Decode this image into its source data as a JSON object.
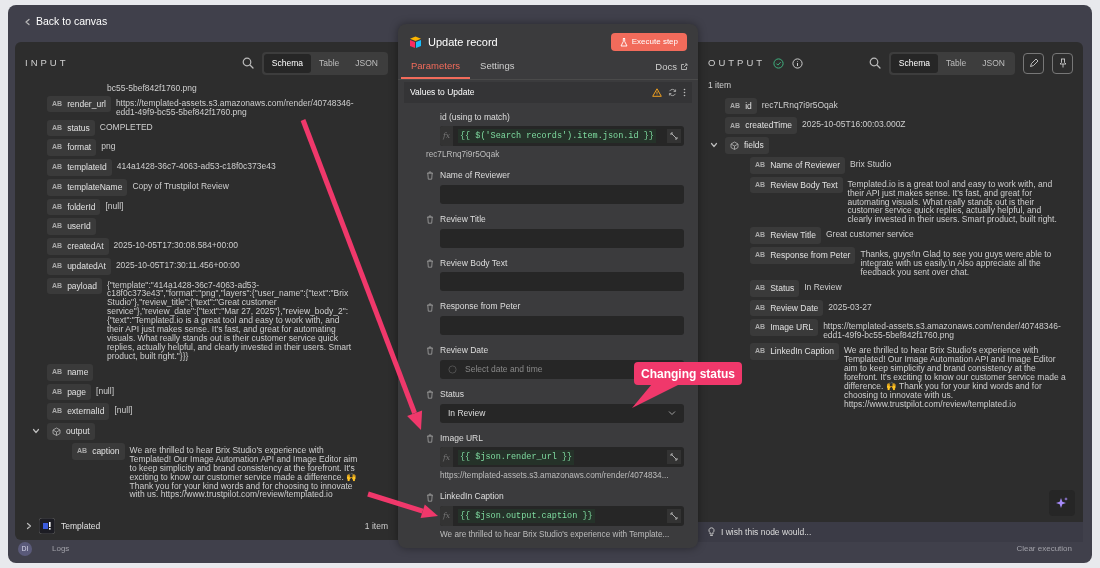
{
  "top_bar": {
    "back_label": "Back to canvas"
  },
  "input_panel": {
    "title": "INPUT",
    "view_tabs": [
      {
        "label": "Schema",
        "selected": true
      },
      {
        "label": "Table",
        "selected": false
      },
      {
        "label": "JSON",
        "selected": false
      }
    ],
    "fields": [
      {
        "kind": "partial",
        "value": "bc55-5bef842f1760.png"
      },
      {
        "kind": "string",
        "type_label": "AB",
        "key": "render_url",
        "value": "https://templated-assets.s3.amazonaws.com/render/40748346-edd1-49f9-bc55-5bef842f1760.png"
      },
      {
        "kind": "string",
        "type_label": "AB",
        "key": "status",
        "value": "COMPLETED"
      },
      {
        "kind": "string",
        "type_label": "AB",
        "key": "format",
        "value": "png"
      },
      {
        "kind": "string",
        "type_label": "AB",
        "key": "templateId",
        "value": "414a1428-36c7-4063-ad53-c18f0c373e43"
      },
      {
        "kind": "string",
        "type_label": "AB",
        "key": "templateName",
        "value": "Copy of Trustpilot Review"
      },
      {
        "kind": "string",
        "type_label": "AB",
        "key": "folderId",
        "value": "[null]"
      },
      {
        "kind": "string",
        "type_label": "AB",
        "key": "userId"
      },
      {
        "kind": "string",
        "type_label": "AB",
        "key": "createdAt",
        "value": "2025-10-05T17:30:08.584+00:00"
      },
      {
        "kind": "string",
        "type_label": "AB",
        "key": "updatedAt",
        "value": "2025-10-05T17:30:11.456+00:00"
      },
      {
        "kind": "string",
        "type_label": "AB",
        "key": "payload",
        "value": "{\"template\":\"414a1428-36c7-4063-ad53-c18f0c373e43\",\"format\":\"png\",\"layers\":{\"user_name\":{\"text\":\"Brix Studio\"},\"review_title\":{\"text\":\"Great customer service\"},\"review_date\":{\"text\":\"Mar 27, 2025\"},\"review_body_2\":{\"text\":\"Templated.io is a great tool and easy to work with, and their API just makes sense. It's fast, and great for automating visuals. What really stands out is their customer service quick replies, actually helpful, and clearly invested in their users. Smart product, built right.\"}}}"
      },
      {
        "kind": "string",
        "type_label": "AB",
        "key": "name"
      },
      {
        "kind": "string",
        "type_label": "AB",
        "key": "page",
        "value": "[null]"
      },
      {
        "kind": "string",
        "type_label": "AB",
        "key": "externalId",
        "value": "[null]"
      },
      {
        "kind": "object",
        "key": "output",
        "expanded": true,
        "children": [
          {
            "kind": "string",
            "type_label": "AB",
            "key": "caption",
            "value": "We are thrilled to hear Brix Studio's experience with Templated! Our Image Automation API and Image Editor aim to keep simplicity and brand consistency at the forefront. It's exciting to know our customer service made a difference. 🙌 Thank you for your kind words and for choosing to innovate with us. https://www.trustpilot.com/review/templated.io"
          }
        ]
      }
    ],
    "source_node": {
      "name": "Templated",
      "count": "1 item",
      "expanded": false
    }
  },
  "node_panel": {
    "title": "Update record",
    "execute_label": "Execute step",
    "tabs": [
      {
        "label": "Parameters",
        "selected": true
      },
      {
        "label": "Settings",
        "selected": false
      }
    ],
    "docs_label": "Docs",
    "section_title": "Values to Update",
    "fields": [
      {
        "kind": "expression",
        "label": "id (using to match)",
        "removable": false,
        "prefix": "fx",
        "expression": "{{ $('Search records').item.json.id }}",
        "result": "rec7LRnq7i9r5Oqak"
      },
      {
        "kind": "text",
        "label": "Name of Reviewer",
        "removable": true
      },
      {
        "kind": "text",
        "label": "Review Title",
        "removable": true
      },
      {
        "kind": "text",
        "label": "Review Body Text",
        "removable": true
      },
      {
        "kind": "text",
        "label": "Response from Peter",
        "removable": true
      },
      {
        "kind": "date",
        "label": "Review Date",
        "removable": true,
        "placeholder": "Select date and time"
      },
      {
        "kind": "select",
        "label": "Status",
        "removable": true,
        "value": "In Review"
      },
      {
        "kind": "expression",
        "label": "Image URL",
        "removable": true,
        "prefix": "fx",
        "expression": "{{ $json.render_url }}",
        "result": "https://templated-assets.s3.amazonaws.com/render/4074834..."
      },
      {
        "kind": "expression",
        "label": "LinkedIn Caption",
        "removable": true,
        "prefix": "fx",
        "expression": "{{ $json.output.caption }}",
        "result": "We are thrilled to hear Brix Studio's experience with Template..."
      }
    ]
  },
  "output_panel": {
    "title": "OUTPUT",
    "item_count": "1 item",
    "view_tabs": [
      {
        "label": "Schema",
        "selected": true
      },
      {
        "label": "Table",
        "selected": false
      },
      {
        "label": "JSON",
        "selected": false
      }
    ],
    "fields": [
      {
        "kind": "string",
        "type_label": "AB",
        "key": "id",
        "value": "rec7LRnq7i9r5Oqak"
      },
      {
        "kind": "string",
        "type_label": "AB",
        "key": "createdTime",
        "value": "2025-10-05T16:00:03.000Z"
      },
      {
        "kind": "object",
        "key": "fields",
        "expanded": true,
        "children": [
          {
            "kind": "string",
            "type_label": "AB",
            "key": "Name of Reviewer",
            "value": "Brix Studio"
          },
          {
            "kind": "string",
            "type_label": "AB",
            "key": "Review Body Text",
            "value": "Templated.io is a great tool and easy to work with, and their API just makes sense. It's fast, and great for automating visuals. What really stands out is their customer service quick replies, actually helpful, and clearly invested in their users. Smart product, built right."
          },
          {
            "kind": "string",
            "type_label": "AB",
            "key": "Review Title",
            "value": "Great customer service"
          },
          {
            "kind": "string",
            "type_label": "AB",
            "key": "Response from Peter",
            "value": "Thanks, guys!\\n Glad to see you guys were able to integrate with us easily.\\n Also appreciate all the feedback you sent over chat."
          },
          {
            "kind": "string",
            "type_label": "AB",
            "key": "Status",
            "value": "In Review"
          },
          {
            "kind": "string",
            "type_label": "AB",
            "key": "Review Date",
            "value": "2025-03-27"
          },
          {
            "kind": "string",
            "type_label": "AB",
            "key": "Image URL",
            "value": "https://templated-assets.s3.amazonaws.com/render/40748346-edd1-49f9-bc55-5bef842f1760.png"
          },
          {
            "kind": "string",
            "type_label": "AB",
            "key": "LinkedIn Caption",
            "value": "We are thrilled to hear Brix Studio's experience with Templated! Our Image Automation API and Image Editor aim to keep simplicity and brand consistency at the forefront. It's exciting to know our customer service made a difference. 🙌 Thank you for your kind words and for choosing to innovate with us. https://www.trustpilot.com/review/templated.io"
          }
        ]
      }
    ],
    "feedback_prompt": "I wish this node would..."
  },
  "bottom_bar": {
    "avatar_initials": "DI",
    "logs_label": "Logs",
    "clear_label": "Clear execution"
  },
  "annotations": [
    {
      "kind": "arrow"
    },
    {
      "kind": "arrow"
    },
    {
      "kind": "callout",
      "text": "Changing status"
    }
  ]
}
